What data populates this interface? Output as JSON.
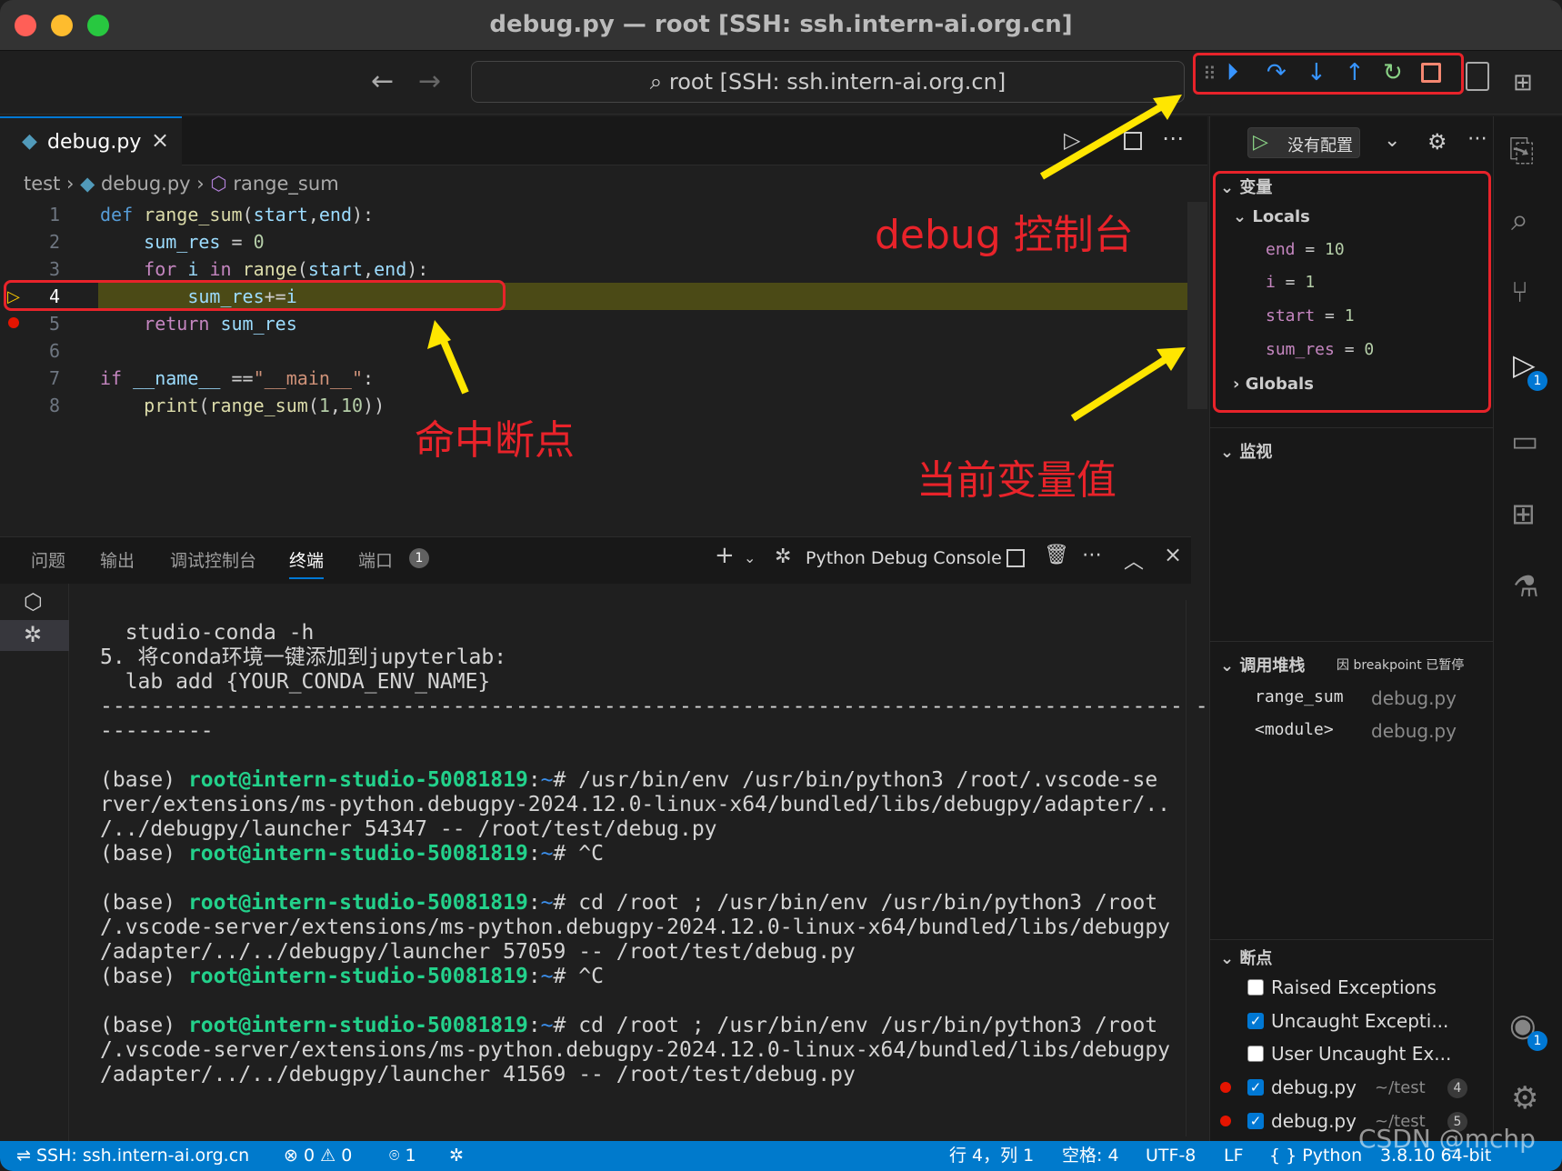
{
  "window": {
    "title": "debug.py — root [SSH: ssh.intern-ai.org.cn]"
  },
  "search": {
    "text": "root [SSH: ssh.intern-ai.org.cn]"
  },
  "editor": {
    "tab": "debug.py",
    "breadcrumb": [
      "test",
      "debug.py",
      "range_sum"
    ],
    "current_line": 4,
    "lines": [
      {
        "n": "1"
      },
      {
        "n": "2"
      },
      {
        "n": "3"
      },
      {
        "n": "4"
      },
      {
        "n": "5"
      },
      {
        "n": "6"
      },
      {
        "n": "7"
      },
      {
        "n": "8"
      }
    ]
  },
  "annotations": {
    "debug_console": "debug 控制台",
    "breakpoint_hit": "命中断点",
    "current_vars": "当前变量值"
  },
  "panel": {
    "tabs": [
      "问题",
      "输出",
      "调试控制台",
      "终端",
      "端口"
    ],
    "ports_count": "1",
    "console_name": "Python Debug Console"
  },
  "terminal": {
    "prompt_user": "root@intern-studio-50081819",
    "lines": [
      "  studio-conda -h",
      "",
      "5. 将conda环境一键添加到jupyterlab:",
      "  lab add {YOUR_CONDA_ENV_NAME}",
      "",
      "------------------------------------------------------------------------------------------",
      "---------"
    ],
    "cmd1_a": " /usr/bin/env /usr/bin/python3 /root/.vscode-se",
    "cmd1_b": "rver/extensions/ms-python.debugpy-2024.12.0-linux-x64/bundled/libs/debugpy/adapter/..",
    "cmd1_c": "/../debugpy/launcher 54347 -- /root/test/debug.py",
    "cmd2_a": " cd /root ; /usr/bin/env /usr/bin/python3 /root",
    "cmd2_b": "/.vscode-server/extensions/ms-python.debugpy-2024.12.0-linux-x64/bundled/libs/debugpy",
    "cmd2_c": "/adapter/../../debugpy/launcher 57059 -- /root/test/debug.py",
    "cmd3_c": "/adapter/../../debugpy/launcher 41569 -- /root/test/debug.py",
    "ctrl_c": "# ^C",
    "base": "(base) ",
    "hash": "#"
  },
  "sidebar": {
    "run_config": "没有配置",
    "variables_title": "变量",
    "locals": "Locals",
    "vars": [
      {
        "name": "end",
        "value": "10"
      },
      {
        "name": "i",
        "value": "1"
      },
      {
        "name": "start",
        "value": "1"
      },
      {
        "name": "sum_res",
        "value": "0"
      }
    ],
    "globals": "Globals",
    "watch": "监视",
    "callstack_title": "调用堆栈",
    "callstack_status": "因 breakpoint 已暂停",
    "frames": [
      {
        "fn": "range_sum",
        "file": "debug.py"
      },
      {
        "fn": "<module>",
        "file": "debug.py"
      }
    ],
    "breakpoints_title": "断点",
    "breakpoints": [
      {
        "label": "Raised Exceptions",
        "checked": false
      },
      {
        "label": "Uncaught Excepti...",
        "checked": true
      },
      {
        "label": "User Uncaught Ex...",
        "checked": false
      },
      {
        "label": "debug.py",
        "path": "~/test",
        "line": "4",
        "checked": true
      },
      {
        "label": "debug.py",
        "path": "~/test",
        "line": "5",
        "checked": true
      }
    ]
  },
  "activity": {
    "debug_badge": "1",
    "account_badge": "1"
  },
  "status": {
    "remote": "SSH: ssh.intern-ai.org.cn",
    "errors": "0",
    "warnings": "0",
    "ports": "1",
    "position": "行 4，列 1",
    "spaces": "空格: 4",
    "encoding": "UTF-8",
    "eol": "LF",
    "lang": "{ } Python",
    "py_version": "3.8.10 64-bit",
    "watermark": "CSDN @mchp"
  },
  "colors": {
    "accent": "#007acc",
    "annotation": "#e8232a",
    "arrow": "#ffe600"
  }
}
